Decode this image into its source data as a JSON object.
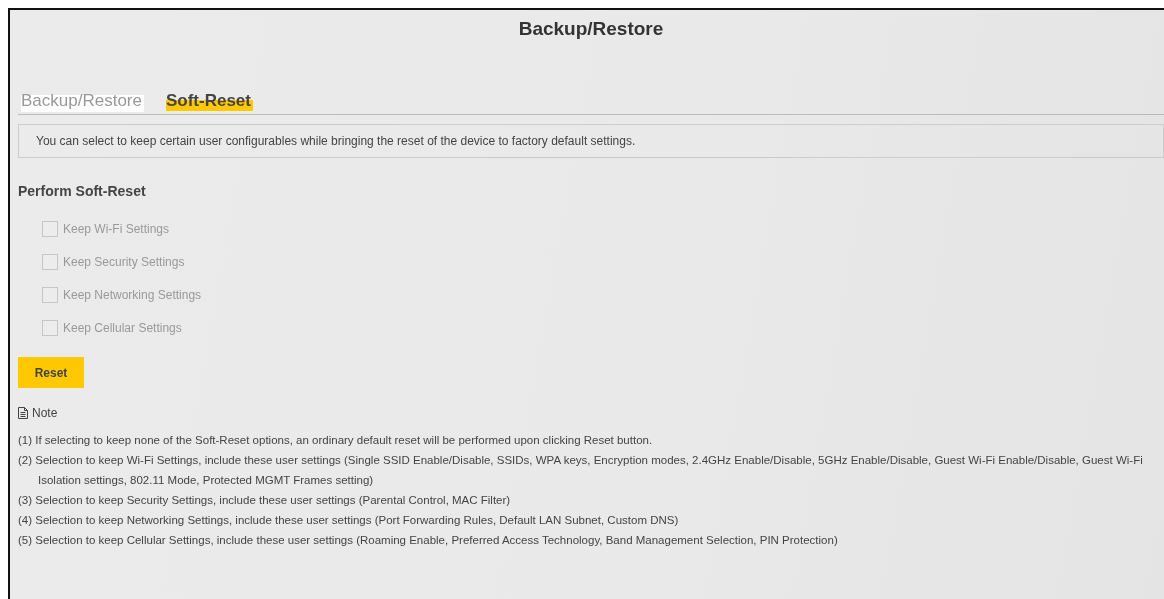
{
  "page_title": "Backup/Restore",
  "tabs": [
    {
      "label": "Backup/Restore",
      "selected": false
    },
    {
      "label": "Soft-Reset",
      "selected": true
    }
  ],
  "description": "You can select to keep certain user configurables while bringing the reset of the device to factory default settings.",
  "section_title": "Perform Soft-Reset",
  "options": [
    {
      "label": "Keep Wi-Fi Settings",
      "checked": false,
      "disabled": true
    },
    {
      "label": "Keep Security Settings",
      "checked": false,
      "disabled": true
    },
    {
      "label": "Keep Networking Settings",
      "checked": false,
      "disabled": true
    },
    {
      "label": "Keep Cellular Settings",
      "checked": false,
      "disabled": true
    }
  ],
  "reset_button": "Reset",
  "note_title": "Note",
  "notes": [
    "(1) If selecting to keep none of the Soft-Reset options, an ordinary default reset will be performed upon clicking Reset button.",
    "(2) Selection to keep Wi-Fi Settings, include these user settings (Single SSID Enable/Disable, SSIDs, WPA keys, Encryption modes, 2.4GHz Enable/Disable, 5GHz Enable/Disable, Guest Wi-Fi Enable/Disable, Guest Wi-Fi Isolation settings, 802.11 Mode, Protected MGMT Frames setting)",
    "(3) Selection to keep Security Settings, include these user settings (Parental Control, MAC Filter)",
    "(4) Selection to keep Networking Settings, include these user settings (Port Forwarding Rules, Default LAN Subnet, Custom DNS)",
    "(5) Selection to keep Cellular Settings, include these user settings (Roaming Enable, Preferred Access Technology, Band Management Selection, PIN Protection)"
  ]
}
